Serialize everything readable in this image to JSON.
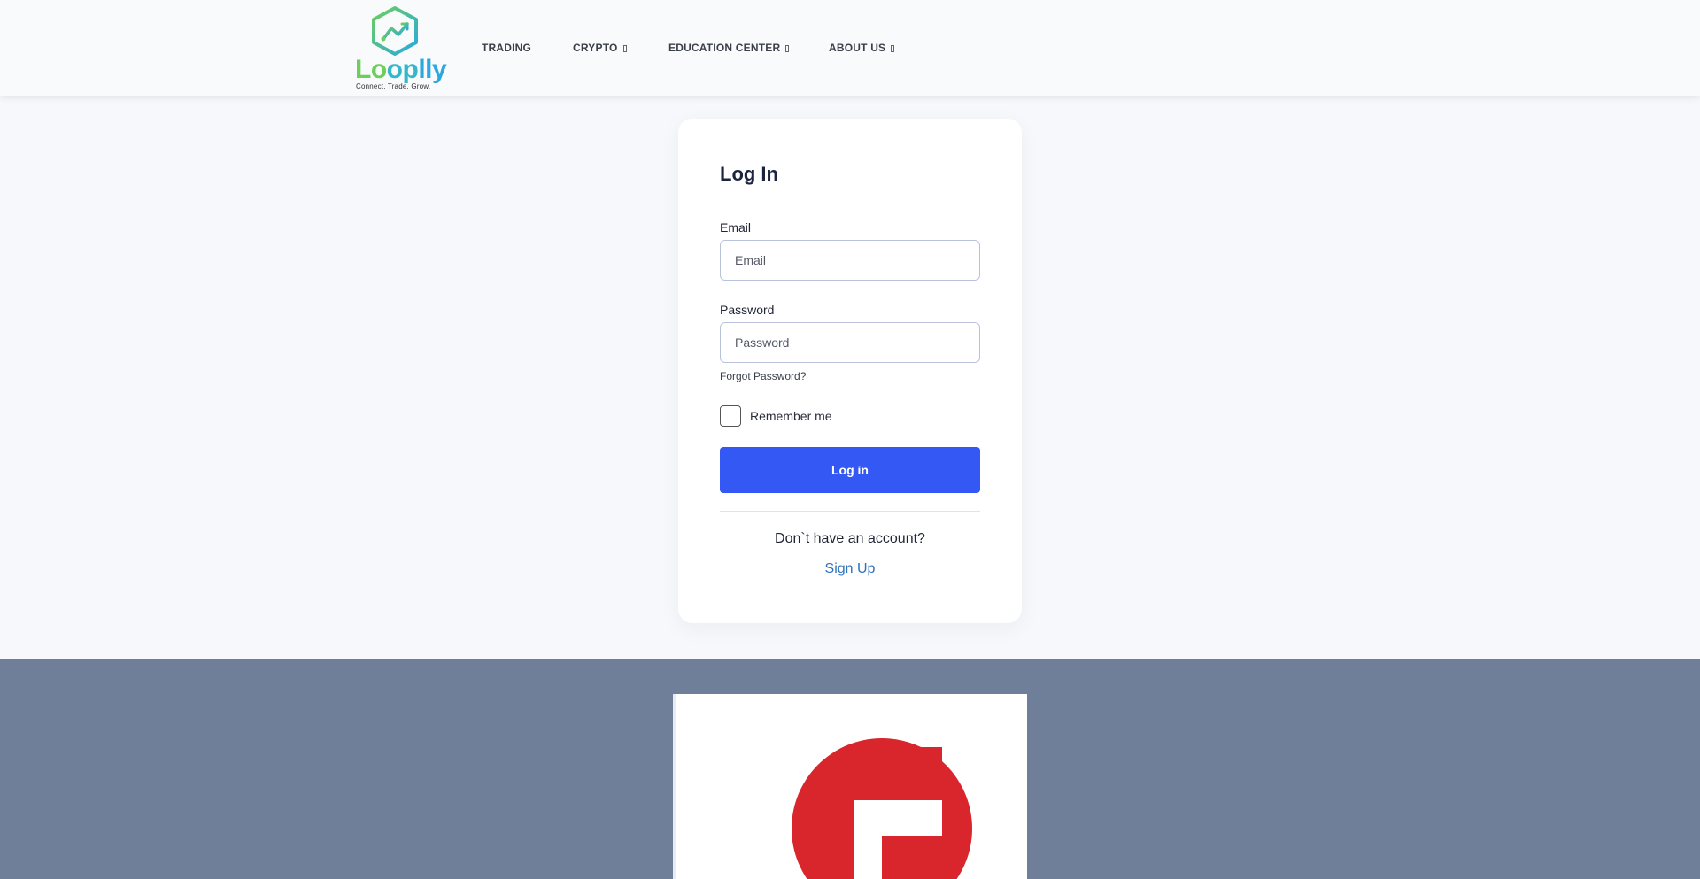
{
  "header": {
    "logo": {
      "word_parts": [
        "Lo",
        "op",
        "lly"
      ],
      "tagline": "Connect. Trade. Grow.",
      "icon": "hexagon-chart-icon"
    },
    "nav": [
      {
        "label": "TRADING",
        "has_dropdown": false
      },
      {
        "label": "CRYPTO",
        "has_dropdown": true
      },
      {
        "label": "EDUCATION CENTER",
        "has_dropdown": true
      },
      {
        "label": "ABOUT US",
        "has_dropdown": true
      }
    ]
  },
  "login": {
    "title": "Log In",
    "email": {
      "label": "Email",
      "placeholder": "Email",
      "value": ""
    },
    "password": {
      "label": "Password",
      "placeholder": "Password",
      "value": ""
    },
    "forgot_label": "Forgot Password?",
    "remember_label": "Remember me",
    "remember_checked": false,
    "submit_label": "Log in",
    "no_account_text": "Don`t have an account?",
    "signup_label": "Sign Up"
  },
  "footer": {
    "banner_icon": "red-circle-logo-icon"
  },
  "colors": {
    "primary_button": "#3358f4",
    "link": "#2f72b9",
    "footer_bg": "#6f7f99",
    "banner_logo_red": "#d9262d"
  }
}
